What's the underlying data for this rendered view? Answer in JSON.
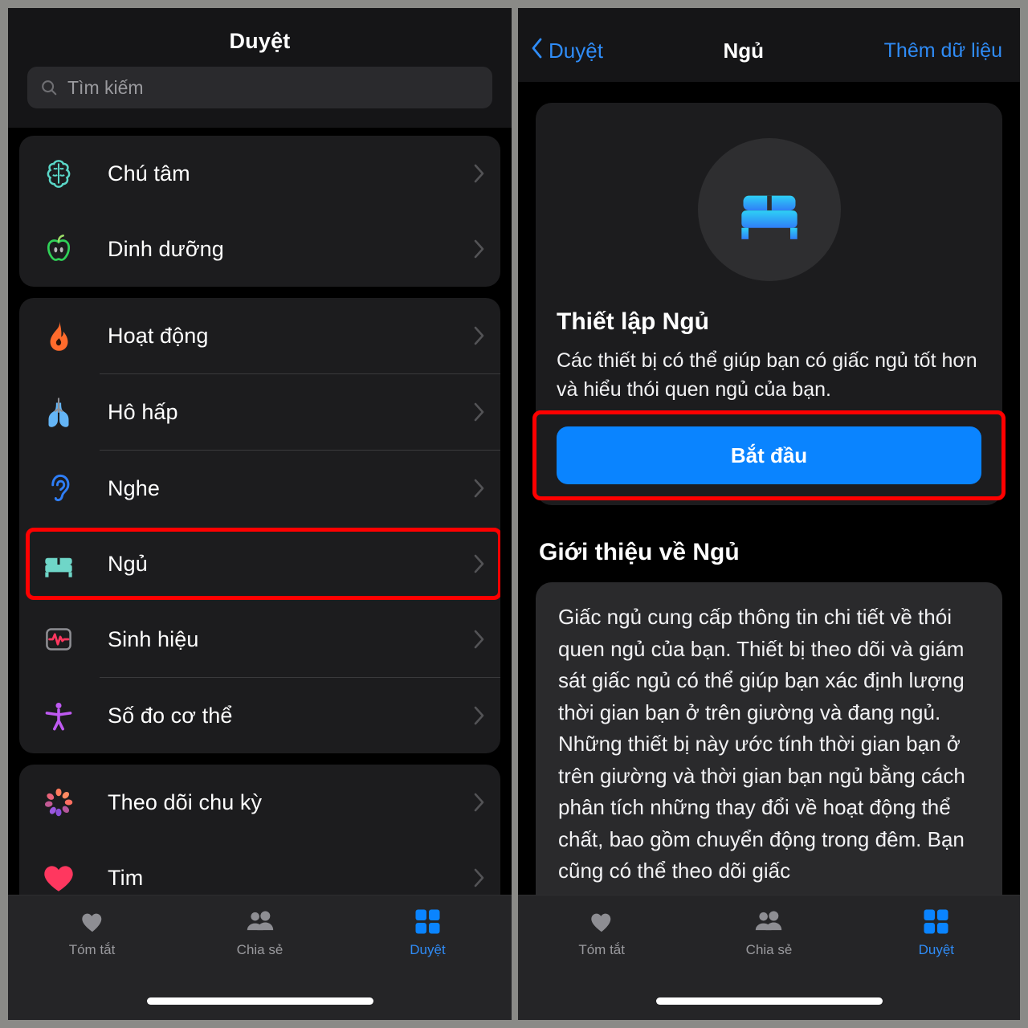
{
  "left": {
    "nav": {
      "title": "Duyệt"
    },
    "search": {
      "placeholder": "Tìm kiếm",
      "icon": "search-icon"
    },
    "groups": [
      {
        "items": [
          {
            "label": "Chú tâm",
            "icon": "brain-icon",
            "color": "#5ad7c8",
            "highlighted": false
          },
          {
            "label": "Dinh dưỡng",
            "icon": "apple-icon",
            "color": "#30d158",
            "highlighted": false
          }
        ]
      },
      {
        "items": [
          {
            "label": "Hoạt động",
            "icon": "flame-icon",
            "color": "#ff6b2c",
            "highlighted": false
          },
          {
            "label": "Hô hấp",
            "icon": "lungs-icon",
            "color": "#64b5f6",
            "highlighted": false
          },
          {
            "label": "Nghe",
            "icon": "ear-icon",
            "color": "#2f7ef7",
            "highlighted": false
          },
          {
            "label": "Ngủ",
            "icon": "bed-icon",
            "color": "#6fd6c8",
            "highlighted": true
          },
          {
            "label": "Sinh hiệu",
            "icon": "vitals-icon",
            "color": "#ff375f",
            "highlighted": false
          },
          {
            "label": "Số đo cơ thể",
            "icon": "body-measure-icon",
            "color": "#bf5af2",
            "highlighted": false
          }
        ]
      },
      {
        "items": [
          {
            "label": "Theo dõi chu kỳ",
            "icon": "cycle-tracking-icon",
            "color": "#ff6f61",
            "highlighted": false
          },
          {
            "label": "Tim",
            "icon": "heart-icon",
            "color": "#ff375f",
            "highlighted": false
          }
        ]
      }
    ],
    "tabs": [
      {
        "label": "Tóm tắt",
        "icon": "heart-icon",
        "active": false
      },
      {
        "label": "Chia sẻ",
        "icon": "people-icon",
        "active": false
      },
      {
        "label": "Duyệt",
        "icon": "grid-icon",
        "active": true
      }
    ]
  },
  "right": {
    "nav": {
      "back_label": "Duyệt",
      "back_icon": "chevron-left-icon",
      "title": "Ngủ",
      "action_label": "Thêm dữ liệu"
    },
    "setup": {
      "icon": "bed-icon",
      "title": "Thiết lập Ngủ",
      "description": "Các thiết bị có thể giúp bạn có giấc ngủ tốt hơn và hiểu thói quen ngủ của bạn.",
      "cta_label": "Bắt đầu",
      "cta_color": "#0a84ff"
    },
    "about": {
      "heading": "Giới thiệu về Ngủ",
      "body": "Giấc ngủ cung cấp thông tin chi tiết về thói quen ngủ của bạn. Thiết bị theo dõi và giám sát giấc ngủ có thể giúp bạn xác định lượng thời gian bạn ở trên giường và đang ngủ. Những thiết bị này ước tính thời gian bạn ở trên giường và thời gian bạn ngủ bằng cách phân tích những thay đổi về hoạt động thể chất, bao gồm chuyển động trong đêm. Bạn cũng có thể theo dõi giấc"
    },
    "tabs": [
      {
        "label": "Tóm tắt",
        "icon": "heart-icon",
        "active": false
      },
      {
        "label": "Chia sẻ",
        "icon": "people-icon",
        "active": false
      },
      {
        "label": "Duyệt",
        "icon": "grid-icon",
        "active": true
      }
    ]
  },
  "annotation": {
    "highlight_color": "#ff0000"
  }
}
